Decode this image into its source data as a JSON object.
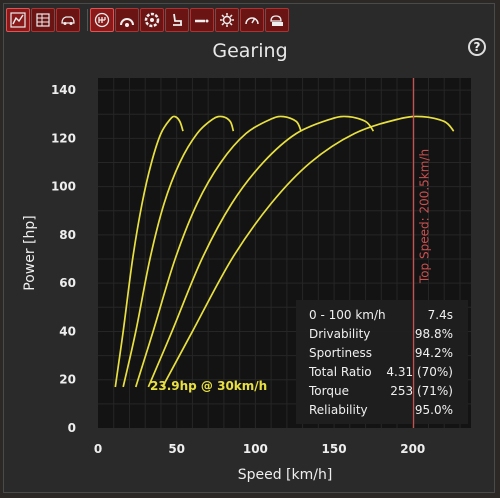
{
  "window": {
    "title": "Gearing",
    "help_label": "?"
  },
  "toolbar": {
    "buttons": [
      {
        "icon": "chart-icon",
        "active": true
      },
      {
        "icon": "spreadsheet-icon",
        "active": false
      },
      {
        "icon": "car-icon",
        "active": false
      },
      {
        "icon": "gearbox-icon",
        "active": true
      },
      {
        "icon": "wheel-arch-icon",
        "active": false
      },
      {
        "icon": "tire-icon",
        "active": false
      },
      {
        "icon": "seat-icon",
        "active": false
      },
      {
        "icon": "exhaust-icon",
        "active": false
      },
      {
        "icon": "gear-icon",
        "active": false
      },
      {
        "icon": "speedometer-icon",
        "active": false
      },
      {
        "icon": "car-settings-icon",
        "active": false
      }
    ]
  },
  "stats": [
    {
      "label": "0 - 100 km/h",
      "value": "7.4s"
    },
    {
      "label": "Drivability",
      "value": "98.8%"
    },
    {
      "label": "Sportiness",
      "value": "94.2%"
    },
    {
      "label": "Total Ratio",
      "value": "4.31 (70%)"
    },
    {
      "label": "Torque",
      "value": "253 (71%)"
    },
    {
      "label": "Reliability",
      "value": "95.0%"
    }
  ],
  "chart_data": {
    "type": "line",
    "xlabel": "Speed [km/h]",
    "ylabel": "Power [hp]",
    "xlim": [
      0,
      237
    ],
    "ylim": [
      0,
      145
    ],
    "x_ticks": [
      0,
      50,
      100,
      150,
      200
    ],
    "y_ticks": [
      0,
      20,
      40,
      60,
      80,
      100,
      120,
      140
    ],
    "grid": true,
    "series_color": "#e8e040",
    "series": [
      {
        "x": [
          11,
          16,
          22,
          28,
          34,
          40,
          46,
          49,
          52,
          54
        ],
        "y": [
          17,
          40,
          70,
          93,
          110,
          122,
          128,
          129,
          127,
          123
        ]
      },
      {
        "x": [
          16,
          24,
          33,
          42,
          52,
          63,
          73,
          79,
          84,
          86
        ],
        "y": [
          17,
          40,
          70,
          93,
          110,
          122,
          128,
          129,
          127,
          123
        ]
      },
      {
        "x": [
          24,
          35,
          49,
          63,
          78,
          94,
          110,
          118,
          126,
          129
        ],
        "y": [
          17,
          40,
          70,
          93,
          110,
          122,
          128,
          129,
          127,
          123
        ]
      },
      {
        "x": [
          32,
          47,
          66,
          85,
          105,
          126,
          148,
          159,
          170,
          175
        ],
        "y": [
          17,
          40,
          70,
          93,
          110,
          122,
          128,
          129,
          127,
          123
        ]
      },
      {
        "x": [
          41,
          60,
          85,
          110,
          135,
          163,
          191,
          206,
          220,
          226
        ],
        "y": [
          17,
          40,
          70,
          93,
          110,
          122,
          128,
          129,
          127,
          123
        ]
      }
    ],
    "top_speed": {
      "x": 200.5,
      "label": "Top Speed: 200.5km/h",
      "color": "#c85050"
    },
    "annotation": {
      "text": "23.9hp @ 30km/h",
      "x": 30,
      "y": 23.9,
      "color": "#e8e040"
    }
  }
}
